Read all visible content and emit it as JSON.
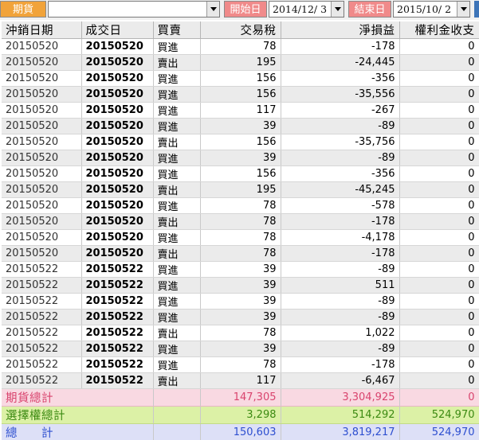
{
  "toolbar": {
    "category_label": "期貨",
    "category_value": "",
    "start_label": "開始日",
    "start_date": "2014/12/ 3",
    "end_label": "結束日",
    "end_date": "2015/10/ 2"
  },
  "columns": [
    "沖銷日期",
    "成交日",
    "買賣",
    "交易稅",
    "淨損益",
    "權利金收支"
  ],
  "rows": [
    [
      "20150520",
      "20150520",
      "買進",
      "78",
      "-178",
      "0"
    ],
    [
      "20150520",
      "20150520",
      "賣出",
      "195",
      "-24,445",
      "0"
    ],
    [
      "20150520",
      "20150520",
      "買進",
      "156",
      "-356",
      "0"
    ],
    [
      "20150520",
      "20150520",
      "買進",
      "156",
      "-35,556",
      "0"
    ],
    [
      "20150520",
      "20150520",
      "買進",
      "117",
      "-267",
      "0"
    ],
    [
      "20150520",
      "20150520",
      "買進",
      "39",
      "-89",
      "0"
    ],
    [
      "20150520",
      "20150520",
      "賣出",
      "156",
      "-35,756",
      "0"
    ],
    [
      "20150520",
      "20150520",
      "買進",
      "39",
      "-89",
      "0"
    ],
    [
      "20150520",
      "20150520",
      "買進",
      "156",
      "-356",
      "0"
    ],
    [
      "20150520",
      "20150520",
      "賣出",
      "195",
      "-45,245",
      "0"
    ],
    [
      "20150520",
      "20150520",
      "買進",
      "78",
      "-578",
      "0"
    ],
    [
      "20150520",
      "20150520",
      "賣出",
      "78",
      "-178",
      "0"
    ],
    [
      "20150520",
      "20150520",
      "買進",
      "78",
      "-4,178",
      "0"
    ],
    [
      "20150520",
      "20150520",
      "賣出",
      "78",
      "-178",
      "0"
    ],
    [
      "20150522",
      "20150522",
      "買進",
      "39",
      "-89",
      "0"
    ],
    [
      "20150522",
      "20150522",
      "買進",
      "39",
      "511",
      "0"
    ],
    [
      "20150522",
      "20150522",
      "買進",
      "39",
      "-89",
      "0"
    ],
    [
      "20150522",
      "20150522",
      "買進",
      "39",
      "-89",
      "0"
    ],
    [
      "20150522",
      "20150522",
      "賣出",
      "78",
      "1,022",
      "0"
    ],
    [
      "20150522",
      "20150522",
      "買進",
      "39",
      "-89",
      "0"
    ],
    [
      "20150522",
      "20150522",
      "買進",
      "78",
      "-178",
      "0"
    ],
    [
      "20150522",
      "20150522",
      "賣出",
      "117",
      "-6,467",
      "0"
    ]
  ],
  "summary": {
    "futures": {
      "label": "期貨總計",
      "tax": "147,305",
      "net": "3,304,925",
      "premium": "0"
    },
    "options": {
      "label": "選擇權總計",
      "tax": "3,298",
      "net": "514,292",
      "premium": "524,970"
    },
    "total": {
      "label": "總　　計",
      "tax": "150,603",
      "net": "3,819,217",
      "premium": "524,970"
    }
  }
}
